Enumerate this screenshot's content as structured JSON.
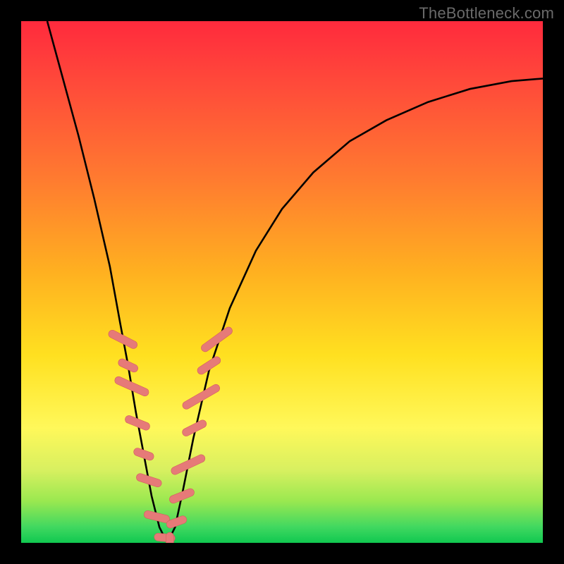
{
  "watermark": "TheBottleneck.com",
  "colors": {
    "frame": "#000000",
    "curve_stroke": "#000000",
    "marker_fill": "#e67a78",
    "marker_stroke": "#d45f5d"
  },
  "chart_data": {
    "type": "line",
    "title": "",
    "xlabel": "",
    "ylabel": "",
    "xlim": [
      0,
      100
    ],
    "ylim": [
      0,
      100
    ],
    "grid": false,
    "legend": false,
    "series": [
      {
        "name": "bottleneck-curve",
        "x": [
          5,
          8,
          11,
          14,
          17,
          19,
          20.5,
          22,
          23.5,
          25,
          26.5,
          28,
          29.5,
          31,
          33,
          36,
          40,
          45,
          50,
          56,
          63,
          70,
          78,
          86,
          94,
          100
        ],
        "y": [
          100,
          89,
          78,
          66,
          53,
          42,
          34,
          25,
          17,
          9,
          3,
          0,
          3,
          10,
          20,
          33,
          45,
          56,
          64,
          71,
          77,
          81,
          84.5,
          87,
          88.5,
          89
        ]
      }
    ],
    "markers": [
      {
        "x": 19.5,
        "y": 39,
        "len": 6,
        "angle": -63
      },
      {
        "x": 20.5,
        "y": 34,
        "len": 4,
        "angle": -65
      },
      {
        "x": 21.2,
        "y": 30,
        "len": 7,
        "angle": -66
      },
      {
        "x": 22.3,
        "y": 23,
        "len": 5,
        "angle": -68
      },
      {
        "x": 23.5,
        "y": 17,
        "len": 4,
        "angle": -70
      },
      {
        "x": 24.5,
        "y": 12,
        "len": 5,
        "angle": -72
      },
      {
        "x": 26.0,
        "y": 5,
        "len": 5,
        "angle": -76
      },
      {
        "x": 27.5,
        "y": 1,
        "len": 4,
        "angle": -85
      },
      {
        "x": 28.5,
        "y": 0.5,
        "len": 3,
        "angle": 0
      },
      {
        "x": 29.8,
        "y": 4,
        "len": 4,
        "angle": 70
      },
      {
        "x": 30.8,
        "y": 9,
        "len": 5,
        "angle": 68
      },
      {
        "x": 32.0,
        "y": 15,
        "len": 7,
        "angle": 65
      },
      {
        "x": 33.2,
        "y": 22,
        "len": 5,
        "angle": 63
      },
      {
        "x": 34.5,
        "y": 28,
        "len": 8,
        "angle": 60
      },
      {
        "x": 36.0,
        "y": 34,
        "len": 5,
        "angle": 57
      },
      {
        "x": 37.5,
        "y": 39,
        "len": 7,
        "angle": 54
      }
    ],
    "vertex_x": 28
  }
}
